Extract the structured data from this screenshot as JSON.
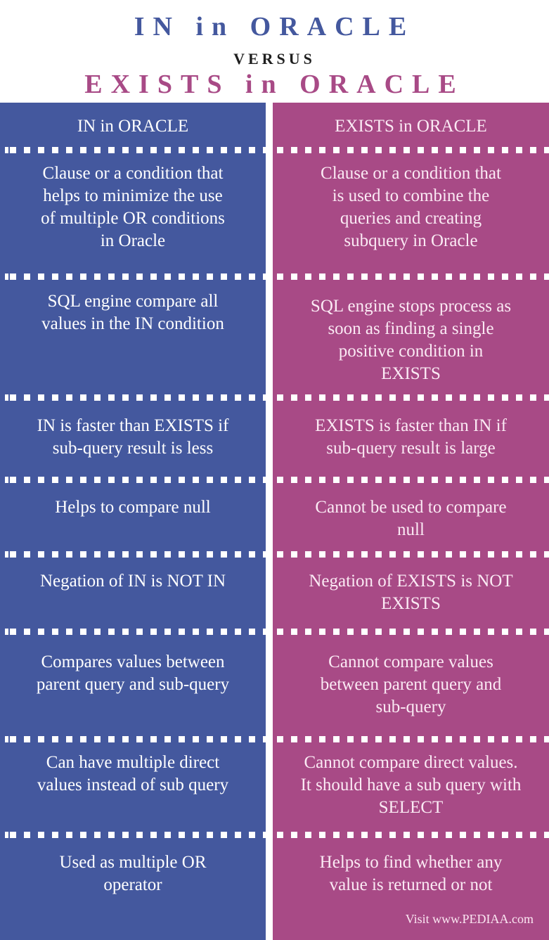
{
  "title": {
    "line1": "IN in ORACLE",
    "line2": "VERSUS",
    "line3": "EXISTS in ORACLE"
  },
  "colors": {
    "left_column": "#44589e",
    "right_column": "#a84a86",
    "text": "#ffffff"
  },
  "left": {
    "header": "IN in ORACLE",
    "rows": [
      [
        "Clause or a condition that",
        "helps to minimize the use",
        "of multiple OR conditions",
        "in Oracle"
      ],
      [
        "SQL engine compare all",
        "values in the IN condition"
      ],
      [
        "IN is faster than EXISTS if",
        "sub-query result is less"
      ],
      [
        "Helps to compare null"
      ],
      [
        "Negation of IN is NOT IN"
      ],
      [
        "Compares values between",
        "parent query and sub-query"
      ],
      [
        "Can have multiple direct",
        "values instead of sub query"
      ],
      [
        "Used as multiple OR",
        "operator"
      ]
    ]
  },
  "right": {
    "header": "EXISTS in ORACLE",
    "rows": [
      [
        "Clause or a condition that",
        "is used to combine the",
        "queries and creating",
        "subquery in Oracle"
      ],
      [
        "SQL engine stops process as",
        "soon as finding a single",
        "positive condition in",
        "EXISTS"
      ],
      [
        "EXISTS is faster than IN if",
        "sub-query result is large"
      ],
      [
        "Cannot be used to compare",
        "null"
      ],
      [
        "Negation of EXISTS is NOT",
        "EXISTS"
      ],
      [
        "Cannot compare values",
        "between parent query and",
        "sub-query"
      ],
      [
        "Cannot compare direct values.",
        "It should have a sub query with",
        "SELECT"
      ],
      [
        "Helps to find whether any",
        "value is returned or not"
      ]
    ]
  },
  "footer": {
    "credit": "Visit www.PEDIAA.com"
  }
}
